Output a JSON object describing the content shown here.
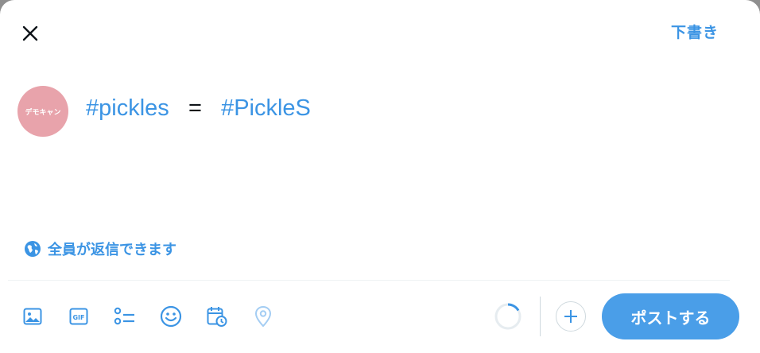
{
  "header": {
    "close_icon": "close-icon",
    "draft_label": "下書き"
  },
  "avatar": {
    "text": "デモキャン",
    "color": "#e8a3ab"
  },
  "compose": {
    "hashtag1": "#pickles",
    "operator": "=",
    "hashtag2": "#PickleS"
  },
  "reply_setting": {
    "icon": "globe-icon",
    "label": "全員が返信できます"
  },
  "toolbar": {
    "tools": [
      "image-icon",
      "gif-icon",
      "poll-icon",
      "emoji-icon",
      "schedule-icon",
      "location-icon"
    ],
    "gif_text": "GIF"
  },
  "post_button": {
    "label": "ポストする"
  },
  "colors": {
    "accent": "#3b94e4",
    "post_button": "#4a9ee8"
  }
}
